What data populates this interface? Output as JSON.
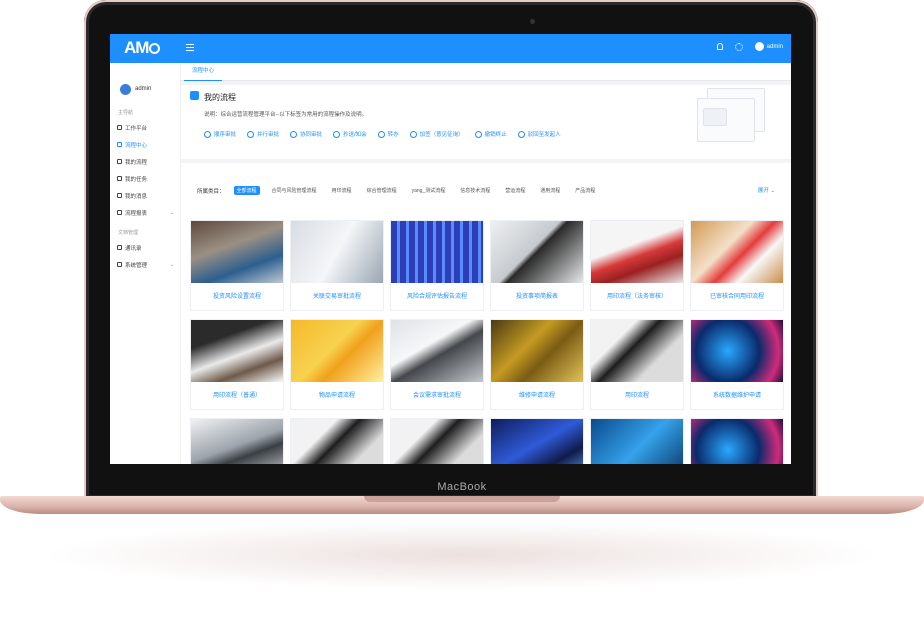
{
  "device": {
    "brand": "MacBook"
  },
  "app": {
    "logo": "AM",
    "user": "admin"
  },
  "sidebar": {
    "user": "admin",
    "section_main": "主导航",
    "items": [
      {
        "label": "工作平台",
        "icon": "home-icon"
      },
      {
        "label": "流程中心",
        "icon": "flow-icon",
        "active": true
      },
      {
        "label": "我的流程",
        "icon": "pin-icon"
      },
      {
        "label": "我的任务",
        "icon": "list-icon"
      },
      {
        "label": "我的消息",
        "icon": "message-icon"
      },
      {
        "label": "流程报表",
        "icon": "clock-icon",
        "expandable": true
      }
    ],
    "section_other": "文档管理",
    "items2": [
      {
        "label": "通讯录",
        "icon": "contacts-icon"
      },
      {
        "label": "系统管理",
        "icon": "gear-icon",
        "expandable": true
      }
    ]
  },
  "tab": "流程中心",
  "header": {
    "title": "我的流程",
    "desc": "说明：综合运营流程管理平台--以下标签为常用的流程操作及说明。",
    "actions": [
      "顺序审批",
      "并行审批",
      "协同审批",
      "抄送/知会",
      "转办",
      "加签（意见征询）",
      "撤销终止",
      "驳回至发起人"
    ]
  },
  "filters": {
    "label": "所属类目：",
    "chips": [
      "全部流程",
      "合同与风险管理流程",
      "用印流程",
      "综合管理流程",
      "yang_测试流程",
      "信息技术流程",
      "营运流程",
      "通用流程",
      "产品流程"
    ],
    "expand": "展开"
  },
  "cards": [
    "投资风险设置流程",
    "关联交易审批流程",
    "风险合规评估报告流程",
    "投资事项简报表",
    "用印流程（法务审核）",
    "已审核合同用印流程",
    "用印流程（普通）",
    "物品申请流程",
    "会议需求审批流程",
    "维修申请流程",
    "用印流程",
    "系统数据维护申请",
    "",
    "",
    "",
    "",
    "",
    ""
  ]
}
